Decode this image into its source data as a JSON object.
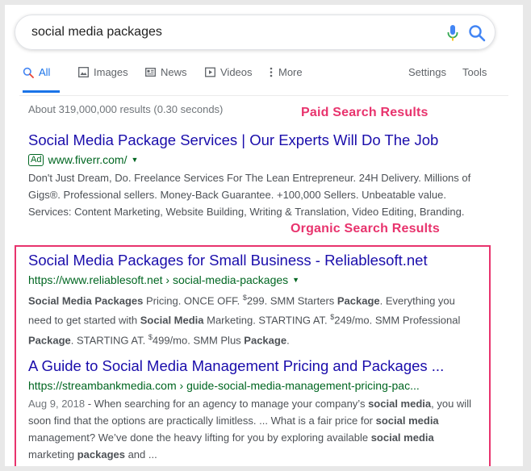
{
  "search": {
    "query": "social media packages"
  },
  "tabs": [
    {
      "label": "All",
      "icon": "search-icon",
      "active": true
    },
    {
      "label": "Images",
      "icon": "image-icon"
    },
    {
      "label": "News",
      "icon": "news-icon"
    },
    {
      "label": "Videos",
      "icon": "video-icon"
    },
    {
      "label": "More",
      "icon": "more-vert-icon"
    }
  ],
  "tools": {
    "settings": "Settings",
    "tools": "Tools"
  },
  "stats": "About 319,000,000 results (0.30 seconds)",
  "annotations": {
    "paid": "Paid Search Results",
    "organic": "Organic Search Results"
  },
  "colors": {
    "annotation": "#e8336d",
    "link": "#1a0dab",
    "url": "#006621",
    "accent": "#1a73e8"
  },
  "results": [
    {
      "title": "Social Media Package Services | Our Experts Will Do The Job",
      "ad_badge": "Ad",
      "url": "www.fiverr.com/",
      "snippet": [
        "Don't Just Dream, Do. Freelance Services For The Lean Entrepreneur. 24H Delivery. Millions of",
        "Gigs®. Professional sellers. Money-Back Guarantee. +100,000 Sellers. Unbeatable value.",
        "Services: Content Marketing, Website Building, Writing & Translation, Video Editing, Branding."
      ]
    },
    {
      "title": "Social Media Packages for Small Business - Reliablesoft.net",
      "url": "https://www.reliablesoft.net › social-media-packages",
      "snippet_parts": {
        "p1": "Social Media Packages",
        "p2": " Pricing. ONCE OFF. ",
        "p3": "$",
        "p4": "299. SMM Starters ",
        "p5": "Package",
        "p6": ". Everything you",
        "p7": "need to get started with ",
        "p8": "Social Media",
        "p9": " Marketing. STARTING AT. ",
        "p10": "$",
        "p11": "249/mo. SMM Professional",
        "p12": "Package",
        "p13": ". STARTING AT. ",
        "p14": "$",
        "p15": "499/mo. SMM Plus ",
        "p16": "Package",
        "p17": "."
      }
    },
    {
      "title": "A Guide to Social Media Management Pricing and Packages ...",
      "url": "https://streambankmedia.com › guide-social-media-management-pricing-pac...",
      "snippet_parts": {
        "date": "Aug 9, 2018",
        "p1": " - When searching for an agency to manage your company’s ",
        "p2": "social media",
        "p3": ", you will",
        "p4": "soon find that the options are practically limitless. ... What is a fair price for ",
        "p5": "social media",
        "p6": "management? We’ve done the heavy lifting for you by exploring available ",
        "p7": "social media",
        "p8": "marketing ",
        "p9": "packages",
        "p10": " and ..."
      }
    }
  ]
}
